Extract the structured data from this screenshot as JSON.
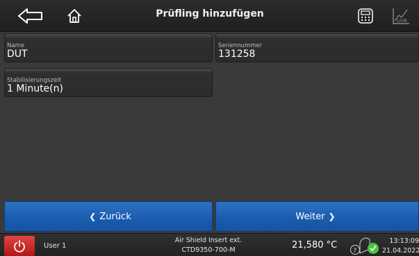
{
  "header": {
    "title": "Prüfling hinzufügen",
    "live_icon_text": "LIVE"
  },
  "fields": [
    {
      "label": "Name",
      "value": "DUT"
    },
    {
      "label": "Seriennummer",
      "value": "131258"
    },
    {
      "label": "Stabilisierungszeit",
      "value": "1 Minute(n)"
    }
  ],
  "nav": {
    "back_label": "Zurück",
    "back_glyph": "❮",
    "next_label": "Weiter",
    "next_glyph": "❯"
  },
  "status": {
    "user": "User 1",
    "device_line1": "Air Shield Insert ext.",
    "device_line2": "CTD9350-700-M",
    "temperature": "21,580 °C",
    "time": "13:13:09",
    "date": "21.04.2022"
  },
  "colors": {
    "accent_blue": "#1b5db0",
    "power_red": "#c92222",
    "ok_green": "#4cc43c"
  }
}
